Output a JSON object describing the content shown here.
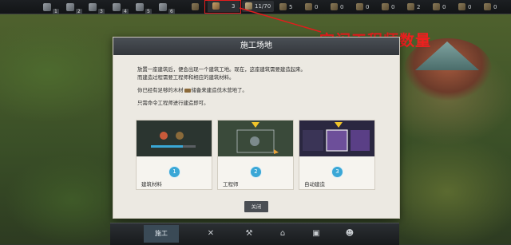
{
  "topbar": {
    "building_counts": [
      "1",
      "2",
      "3",
      "4",
      "5",
      "6"
    ],
    "worker_count": "3",
    "population": "11/70",
    "resources": [
      "5",
      "0",
      "0",
      "0",
      "0",
      "2",
      "0",
      "0",
      "0"
    ]
  },
  "annotation": "空闲工程师数量",
  "dialog": {
    "title": "施工场地",
    "paragraphs": {
      "p1": "放置一座建筑后，便会出现一个建筑工地。现在，这座建筑需要建造起来。",
      "p2": "而建造过程需要工程师和相应的建筑材料。",
      "p3_pre": "你已经有足够的木材",
      "p3_post": "储备来建造伐木营地了。",
      "p4": "只需命令工程师进行建造即可。"
    },
    "cards": [
      {
        "num": "1",
        "label": "建筑材料"
      },
      {
        "num": "2",
        "label": "工程师"
      },
      {
        "num": "3",
        "label": "自动建造"
      }
    ],
    "close_label": "关闭"
  },
  "bottombar": {
    "active_tab": "施工"
  },
  "colors": {
    "highlight": "#e21d1d",
    "accent": "#3aa7d6"
  }
}
